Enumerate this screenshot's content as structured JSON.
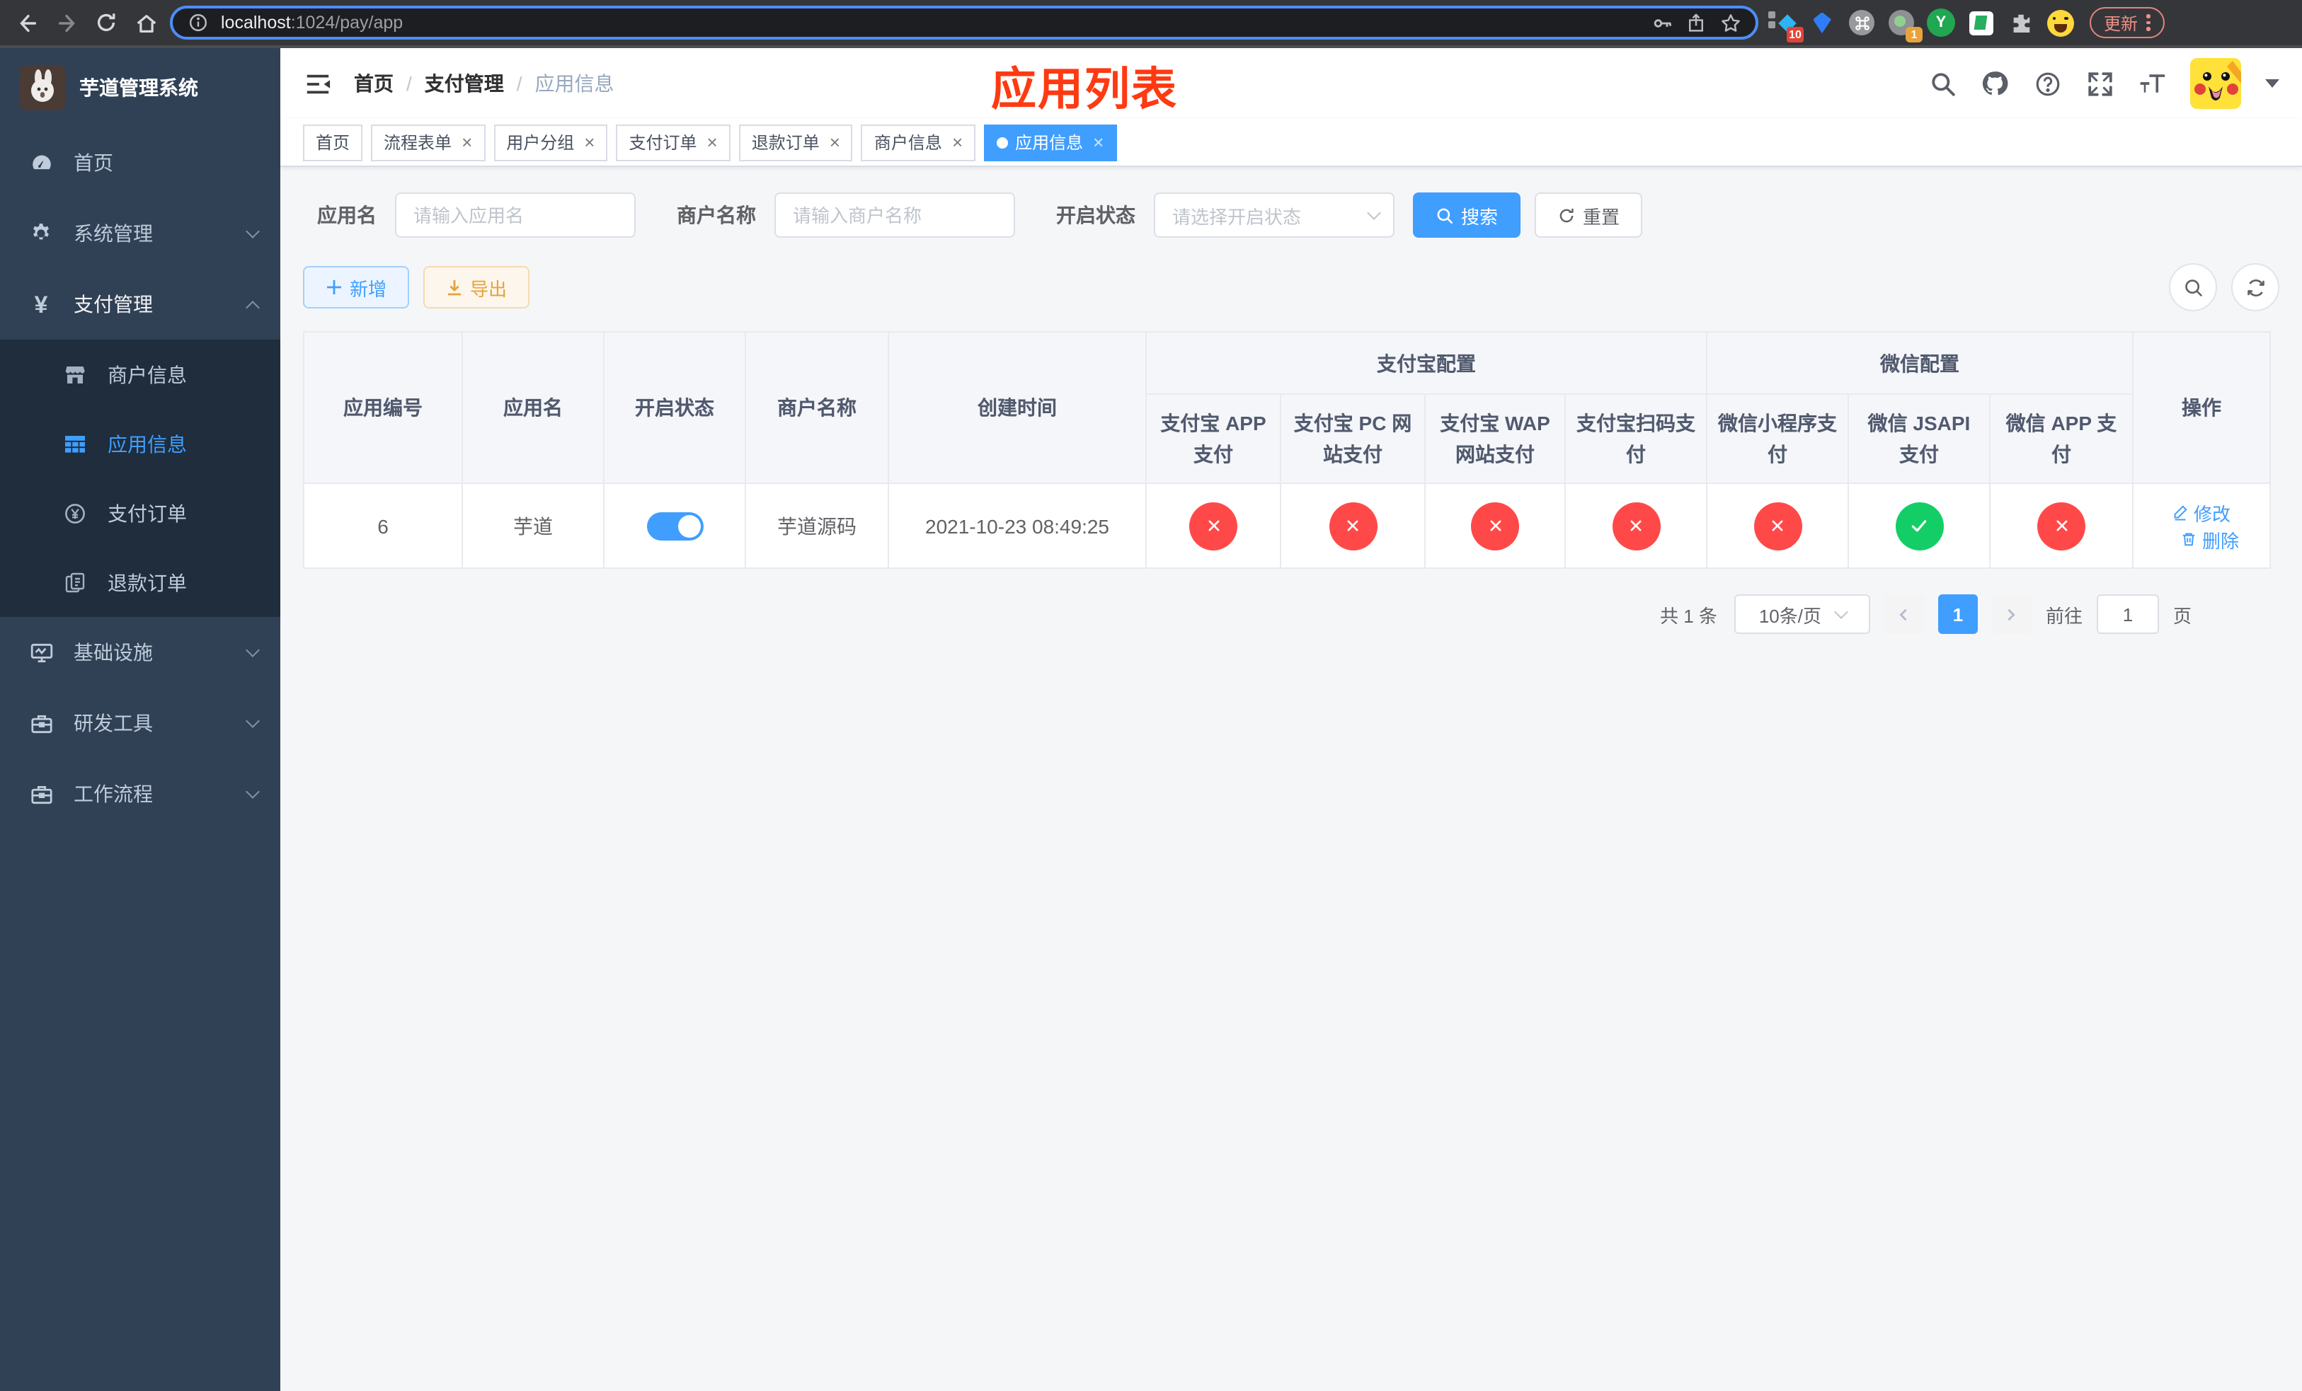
{
  "browser": {
    "url_host": "localhost",
    "url_rest": ":1024/pay/app",
    "update_label": "更新",
    "ext_badge_blue": "10",
    "ext_badge_orange": "1",
    "ext_y_letter": "Y"
  },
  "sidebar": {
    "title": "芋道管理系统",
    "menu": {
      "home": "首页",
      "system": "系统管理",
      "payment": "支付管理",
      "merchant_info": "商户信息",
      "app_info": "应用信息",
      "pay_order": "支付订单",
      "refund_order": "退款订单",
      "infrastructure": "基础设施",
      "dev_tools": "研发工具",
      "workflow": "工作流程"
    }
  },
  "header": {
    "breadcrumb": [
      "首页",
      "支付管理",
      "应用信息"
    ],
    "annotation": "应用列表"
  },
  "tags": [
    {
      "label": "首页",
      "closable": false,
      "active": false
    },
    {
      "label": "流程表单",
      "closable": true,
      "active": false
    },
    {
      "label": "用户分组",
      "closable": true,
      "active": false
    },
    {
      "label": "支付订单",
      "closable": true,
      "active": false
    },
    {
      "label": "退款订单",
      "closable": true,
      "active": false
    },
    {
      "label": "商户信息",
      "closable": true,
      "active": false
    },
    {
      "label": "应用信息",
      "closable": true,
      "active": true
    }
  ],
  "search": {
    "app_name_label": "应用名",
    "app_name_placeholder": "请输入应用名",
    "merchant_label": "商户名称",
    "merchant_placeholder": "请输入商户名称",
    "status_label": "开启状态",
    "status_placeholder": "请选择开启状态",
    "search_button": "搜索",
    "reset_button": "重置"
  },
  "toolbar": {
    "add_button": "新增",
    "export_button": "导出"
  },
  "table": {
    "group_alipay": "支付宝配置",
    "group_wechat": "微信配置",
    "col_id": "应用编号",
    "col_name": "应用名",
    "col_status": "开启状态",
    "col_merchant": "商户名称",
    "col_created": "创建时间",
    "col_alipay_app": "支付宝 APP 支付",
    "col_alipay_pc": "支付宝 PC 网站支付",
    "col_alipay_wap": "支付宝 WAP 网站支付",
    "col_alipay_qr": "支付宝扫码支付",
    "col_wx_mini": "微信小程序支付",
    "col_wx_jsapi": "微信 JSAPI 支付",
    "col_wx_app": "微信 APP 支付",
    "col_ops": "操作",
    "row": {
      "id": "6",
      "name": "芋道",
      "enabled": true,
      "merchant": "芋道源码",
      "created": "2021-10-23 08:49:25",
      "statuses": [
        false,
        false,
        false,
        false,
        false,
        true,
        false
      ],
      "edit_label": "修改",
      "delete_label": "删除"
    }
  },
  "pagination": {
    "total": "共 1 条",
    "page_size": "10条/页",
    "current_page": "1",
    "goto_label": "前往",
    "goto_value": "1",
    "page_label": "页"
  },
  "colors": {
    "accent": "#409eff",
    "success": "#13ce66",
    "danger": "#ff4949",
    "sidebar_bg": "#304156",
    "submenu_bg": "#1f2d3d",
    "annotation_red": "#fe3a12"
  }
}
